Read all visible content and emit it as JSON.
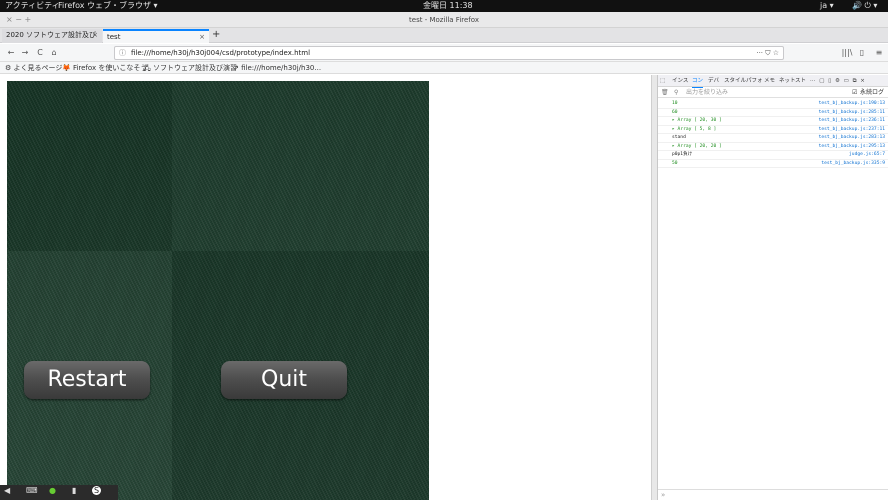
{
  "topbar": {
    "activities": "アクティビティ",
    "app": "Firefox ウェブ・ブラウザ ▾",
    "clock": "金曜日 11:38",
    "lang": "ja ▾",
    "tray": "🔊 ⏻ ▾"
  },
  "window": {
    "title": "test - Mozilla Firefox",
    "controls": "× − +"
  },
  "tabs": [
    {
      "label": "2020 ソフトウェア設計及び",
      "close": "×"
    },
    {
      "label": "test",
      "close": "×"
    }
  ],
  "new_tab": "+",
  "nav": {
    "back": "←",
    "forward": "→",
    "reload": "C",
    "home": "⌂",
    "url": "file:///home/h30j/h30j004/csd/prototype/index.html",
    "url_icon": "ⓘ",
    "page_actions": "··· ⛉ ☆",
    "library": "|||\\",
    "sidebar": "▯",
    "menu": "≡"
  },
  "bookmarks": [
    "⚙ よく見るページ",
    "🦊 Firefox を使いこなそう",
    "🖧 ソフトウェア設計及び演習",
    "⇗ file:///home/h30j/h30..."
  ],
  "game": {
    "restart_label": "Restart",
    "quit_label": "Quit"
  },
  "dock": {
    "items": [
      "◀",
      "⌨",
      "●",
      "▮",
      "S"
    ]
  },
  "devtools": {
    "tabs": [
      "インス",
      "コン",
      "デバ",
      "スタイル",
      "パフォ",
      "メモ",
      "ネット",
      "スト"
    ],
    "toolbar_icons": "⋯ ▢ ▯ ⚙ ▭ ⧉ ×",
    "filter_placeholder": "出力を絞り込み",
    "persist_label": "永続ログ",
    "trash": "🗑",
    "filter_icon": "⚲",
    "input_prompt": "»",
    "colors": {
      "number": "#1c8c1c",
      "link": "#0b6fd1",
      "text": "#222222"
    },
    "logs": [
      {
        "msg": "10",
        "src": "test_bj_backup.js:190:13",
        "color": "#1c8c1c"
      },
      {
        "msg": "60",
        "src": "test_bj_backup.js:285:11",
        "color": "#1c8c1c"
      },
      {
        "msg": "▸ Array [ 20, 30 ]",
        "src": "test_bj_backup.js:236:11",
        "color": "#1c8c1c"
      },
      {
        "msg": "▸ Array [ 5, 8 ]",
        "src": "test_bj_backup.js:237:11",
        "color": "#1c8c1c"
      },
      {
        "msg": "stand",
        "src": "test_bj_backup.js:283:13",
        "color": "#222222"
      },
      {
        "msg": "▸ Array [ 20, 20 ]",
        "src": "test_bj_backup.js:295:13",
        "color": "#1c8c1c"
      },
      {
        "msg": "p0p1負け",
        "src": "judge.js:65:7",
        "color": "#222222"
      },
      {
        "msg": "50",
        "src": "test_bj_backup.js:335:9",
        "color": "#1c8c1c"
      }
    ]
  }
}
